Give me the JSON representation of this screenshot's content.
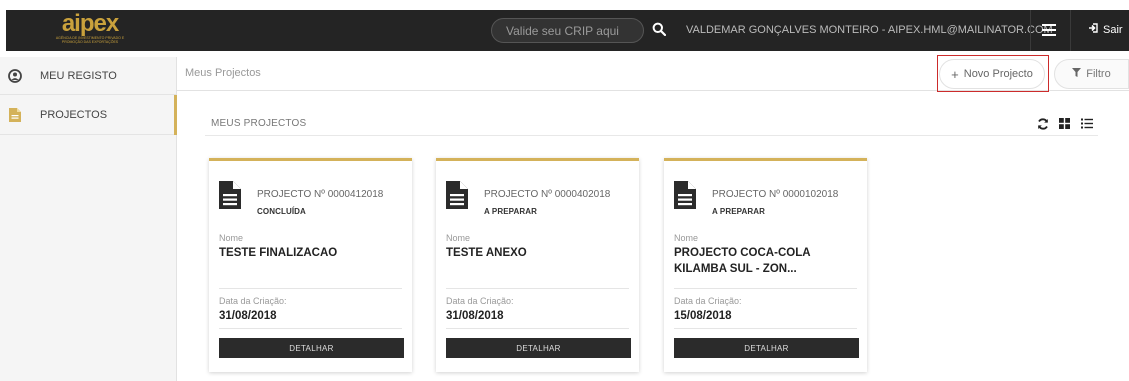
{
  "brand": {
    "logo_text": "aipex",
    "logo_subtitle": "AGÊNCIA DE INVESTIMENTO PRIVADO E PROMOÇÃO DAS EXPORTAÇÕES",
    "accent": "#d4b25a"
  },
  "topbar": {
    "crip_placeholder": "Valide seu CRIP aqui",
    "user": "VALDEMAR GONÇALVES MONTEIRO - AIPEX.HML@MAILINATOR.COM",
    "logout_label": "Sair"
  },
  "sidebar": {
    "items": [
      {
        "label": "MEU REGISTO",
        "icon": "user-circle-icon"
      },
      {
        "label": "PROJECTOS",
        "icon": "document-icon",
        "active": true
      }
    ]
  },
  "header": {
    "breadcrumb": "Meus Projectos",
    "new_project_label": "Novo Projecto",
    "filter_label": "Filtro"
  },
  "main": {
    "section_title": "MEUS PROJECTOS",
    "name_label": "Nome",
    "date_label": "Data da Criação:",
    "detail_label": "DETALHAR",
    "projects": [
      {
        "number": "PROJECTO Nº 0000412018",
        "status": "CONCLUÍDA",
        "name": "TESTE FINALIZACAO",
        "date": "31/08/2018"
      },
      {
        "number": "PROJECTO Nº 0000402018",
        "status": "A PREPARAR",
        "name": "TESTE ANEXO",
        "date": "31/08/2018"
      },
      {
        "number": "PROJECTO Nº 0000102018",
        "status": "A PREPARAR",
        "name": "PROJECTO COCA-COLA KILAMBA SUL - ZON...",
        "date": "15/08/2018"
      }
    ]
  }
}
